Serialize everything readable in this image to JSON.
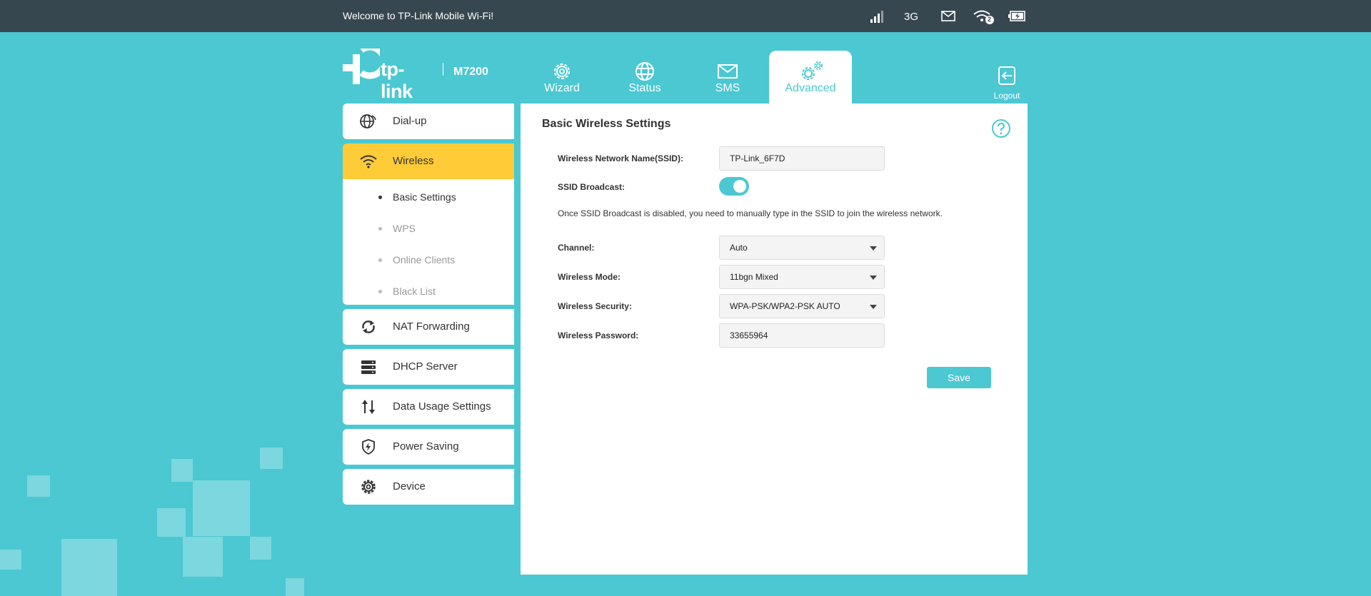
{
  "topbar": {
    "welcome": "Welcome to TP-Link Mobile Wi-Fi!",
    "network_type": "3G",
    "wifi_clients": "2",
    "icons": [
      "signal-icon",
      "mail-icon",
      "wifi-clients-icon",
      "battery-icon"
    ]
  },
  "brand": {
    "logo_text": "tp-link",
    "model": "M7200"
  },
  "nav": {
    "tabs": [
      {
        "label": "Wizard",
        "icon": "gear-icon"
      },
      {
        "label": "Status",
        "icon": "globe-icon"
      },
      {
        "label": "SMS",
        "icon": "envelope-icon"
      },
      {
        "label": "Advanced",
        "icon": "gears-icon",
        "active": true
      }
    ],
    "logout": "Logout"
  },
  "sidebar": {
    "items": [
      {
        "label": "Dial-up",
        "icon": "globe-dialup-icon"
      },
      {
        "label": "Wireless",
        "icon": "wifi-icon",
        "active": true
      },
      {
        "label": "NAT Forwarding",
        "icon": "refresh-icon"
      },
      {
        "label": "DHCP Server",
        "icon": "server-icon"
      },
      {
        "label": "Data Usage Settings",
        "icon": "up-down-arrows-icon"
      },
      {
        "label": "Power Saving",
        "icon": "shield-bolt-icon"
      },
      {
        "label": "Device",
        "icon": "gear-icon"
      }
    ],
    "wireless_sub": [
      {
        "label": "Basic Settings",
        "current": true
      },
      {
        "label": "WPS"
      },
      {
        "label": "Online Clients"
      },
      {
        "label": "Black List"
      }
    ]
  },
  "main": {
    "title": "Basic Wireless Settings",
    "ssid_label": "Wireless Network Name(SSID):",
    "ssid_value": "TP-Link_6F7D",
    "broadcast_label": "SSID Broadcast:",
    "broadcast_on": true,
    "note": "Once SSID Broadcast is disabled, you need to manually type in the SSID to join the wireless network.",
    "channel_label": "Channel:",
    "channel_value": "Auto",
    "mode_label": "Wireless Mode:",
    "mode_value": "11bgn Mixed",
    "security_label": "Wireless Security:",
    "security_value": "WPA-PSK/WPA2-PSK AUTO",
    "password_label": "Wireless Password:",
    "password_value": "33655964",
    "save_label": "Save"
  },
  "colors": {
    "accent": "#4bc8d2",
    "topbar": "#37474f",
    "active_sidebar": "#ffcb36"
  }
}
